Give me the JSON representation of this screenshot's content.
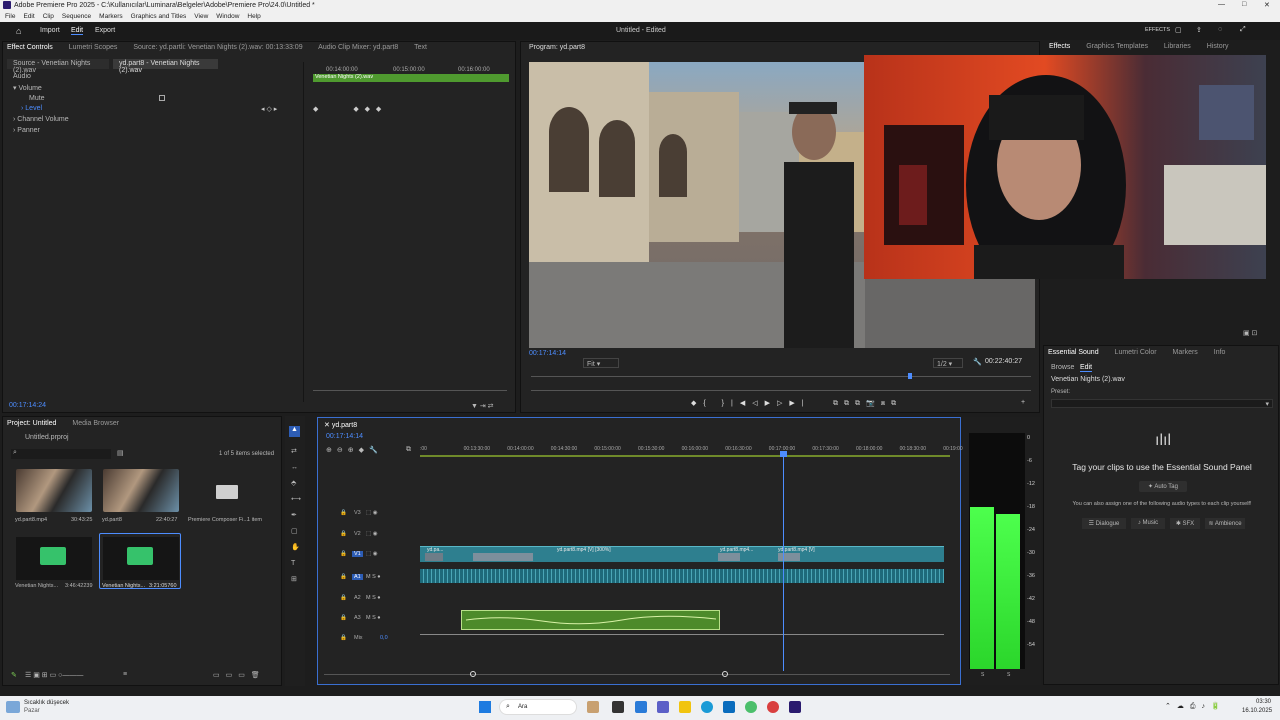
{
  "app": {
    "title": "Adobe Premiere Pro 2025 - C:\\Kullanıcılar\\Luminara\\Belgeler\\Adobe\\Premiere Pro\\24.0\\Untitled *",
    "document_title": "Untitled - Edited",
    "menu": [
      "File",
      "Edit",
      "Clip",
      "Sequence",
      "Markers",
      "Graphics and Titles",
      "View",
      "Window",
      "Help"
    ],
    "workspace": {
      "import": "Import",
      "edit": "Edit",
      "export": "Export"
    },
    "right_label": "EFFECTS"
  },
  "effect_controls": {
    "tabs": [
      "Effect Controls",
      "Lumetri Scopes",
      "Source: yd.partli: Venetian Nights (2).wav: 00:13:33:09",
      "Audio Clip Mixer: yd.part8",
      "Text"
    ],
    "source_label": "Source - Venetian Nights (2).wav",
    "clip_label": "yd.part8 - Venetian Nights (2).wav",
    "section": "Audio",
    "rows": [
      "Volume",
      "Mute",
      "Level",
      "Channel Volume",
      "Panner"
    ],
    "ruler": [
      "00:14:00:00",
      "00:15:00:00",
      "00:16:00:00"
    ],
    "clip_bar": "Venetian Nights (2).wav",
    "timecode": "00:17:14:24"
  },
  "program": {
    "title": "Program: yd.part8",
    "timecode": "00:17:14:14",
    "fit": "Fit",
    "quality": "1/2",
    "duration": "00:22:40:27"
  },
  "effects_panel": {
    "tabs": [
      "Effects",
      "Graphics Templates",
      "Libraries",
      "History"
    ]
  },
  "essential_sound": {
    "tabs": [
      "Essential Sound",
      "Lumetri Color",
      "Markers",
      "Info"
    ],
    "subtabs": [
      "Browse",
      "Edit"
    ],
    "clip": "Venetian Nights (2).wav",
    "preset": "Preset:",
    "headline": "Tag your clips to use the Essential Sound Panel",
    "auto_tag": "Auto Tag",
    "hint": "You can also assign one of the following audio types to each clip yourself!",
    "types": [
      "Dialogue",
      "Music",
      "SFX",
      "Ambience"
    ]
  },
  "project": {
    "tabs": [
      "Project: Untitled",
      "Media Browser"
    ],
    "file": "Untitled.prproj",
    "selected": "1 of 5 items selected",
    "items": [
      {
        "name": "yd.part8.mp4",
        "dur": "30:43:25",
        "kind": "video"
      },
      {
        "name": "yd.part8",
        "dur": "22:40:27",
        "kind": "video"
      },
      {
        "name": "Premiere Composer Fi...",
        "dur": "1 item",
        "kind": "folder"
      },
      {
        "name": "Venetian Nights...",
        "dur": "3:46:42239",
        "kind": "audio"
      },
      {
        "name": "Venetian Nights...",
        "dur": "3:21:05760",
        "kind": "audio"
      }
    ]
  },
  "timeline": {
    "title": "yd.part8",
    "timecode": "00:17:14:14",
    "ruler": [
      ":00",
      "00:13:30:00",
      "00:14:00:00",
      "00:14:30:00",
      "00:15:00:00",
      "00:15:30:00",
      "00:16:00:00",
      "00:16:30:00",
      "00:17:00:00",
      "00:17:30:00",
      "00:18:00:00",
      "00:18:30:00",
      "00:19:00:00"
    ],
    "tracks": [
      "V3",
      "V2",
      "V1",
      "A1",
      "A2",
      "A3",
      "Mix"
    ],
    "clip_labels": [
      "yd.pa...",
      "yd.part8.mp4 [V] [300%]",
      "yd.part8.mp4...",
      "yd.part8.mp4 [V]"
    ],
    "mix_value": "0,0"
  },
  "meters": {
    "scale": [
      "0",
      "-6",
      "-12",
      "-18",
      "-24",
      "-30",
      "-36",
      "-42",
      "-48",
      "-54"
    ],
    "footer": [
      "S",
      "S"
    ]
  },
  "taskbar": {
    "weather": "Sıcaklık düşecek",
    "weather2": "Pazar",
    "search": "Ara",
    "time": "03:30",
    "date": "16.10.2025"
  }
}
